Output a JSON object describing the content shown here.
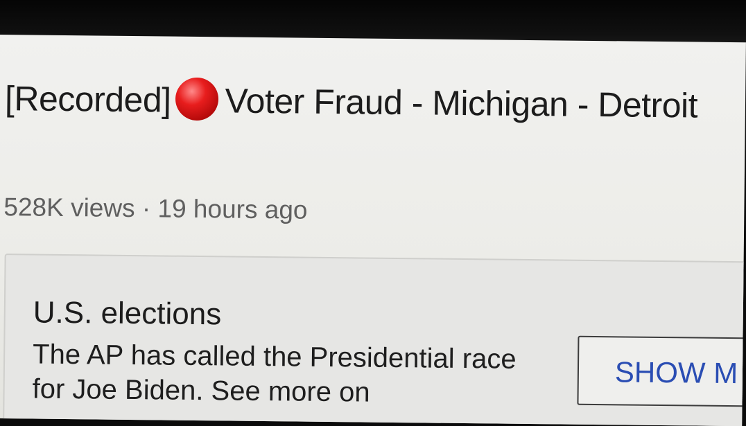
{
  "video": {
    "title_prefix": "[Recorded]",
    "title_main": "Voter Fraud - Michigan - Detroit",
    "record_icon": "red-circle-icon",
    "views": "528K views",
    "separator": "·",
    "age": "19 hours ago"
  },
  "info_panel": {
    "heading": "U.S. elections",
    "body": "The AP has called the Presidential race for Joe Biden. See more on",
    "button_label": "SHOW M",
    "button_color": "#2a4db3"
  }
}
